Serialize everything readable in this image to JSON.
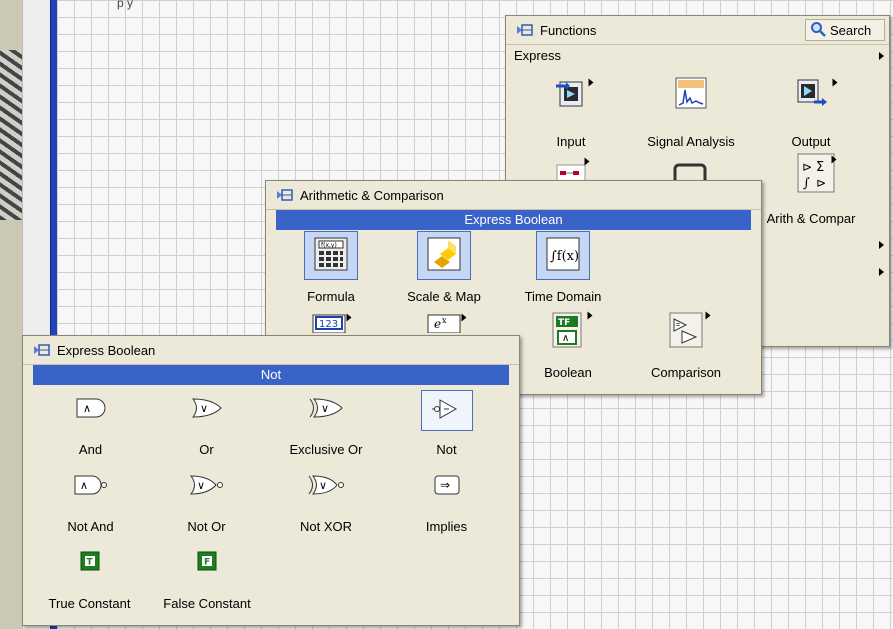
{
  "canvas_top_text": "p                                             y",
  "functions": {
    "title": "Functions",
    "search": "Search",
    "category": "Express",
    "items": [
      {
        "label": "Input",
        "icon": "input-icon"
      },
      {
        "label": "Signal Analysis",
        "icon": "signal-analysis-icon"
      },
      {
        "label": "Output",
        "icon": "output-icon"
      },
      {
        "label": "Arith & Compar",
        "icon": "arith-compar-icon"
      }
    ]
  },
  "arith": {
    "title": "Arithmetic & Comparison",
    "selected": "Express Boolean",
    "items": [
      {
        "label": "Formula",
        "icon": "formula-icon"
      },
      {
        "label": "Scale & Map",
        "icon": "scale-map-icon"
      },
      {
        "label": "Time Domain",
        "icon": "time-domain-icon"
      },
      {
        "label": "Boolean",
        "icon": "boolean-icon"
      },
      {
        "label": "Comparison",
        "icon": "comparison-icon"
      }
    ]
  },
  "boolean": {
    "title": "Express Boolean",
    "selected": "Not",
    "items": [
      {
        "label": "And",
        "icon": "and-icon"
      },
      {
        "label": "Or",
        "icon": "or-icon"
      },
      {
        "label": "Exclusive Or",
        "icon": "exclusive-or-icon"
      },
      {
        "label": "Not",
        "icon": "not-icon"
      },
      {
        "label": "Not And",
        "icon": "not-and-icon"
      },
      {
        "label": "Not Or",
        "icon": "not-or-icon"
      },
      {
        "label": "Not XOR",
        "icon": "not-xor-icon"
      },
      {
        "label": "Implies",
        "icon": "implies-icon"
      },
      {
        "label": "True Constant",
        "icon": "true-constant-icon"
      },
      {
        "label": "False Constant",
        "icon": "false-constant-icon"
      }
    ]
  }
}
